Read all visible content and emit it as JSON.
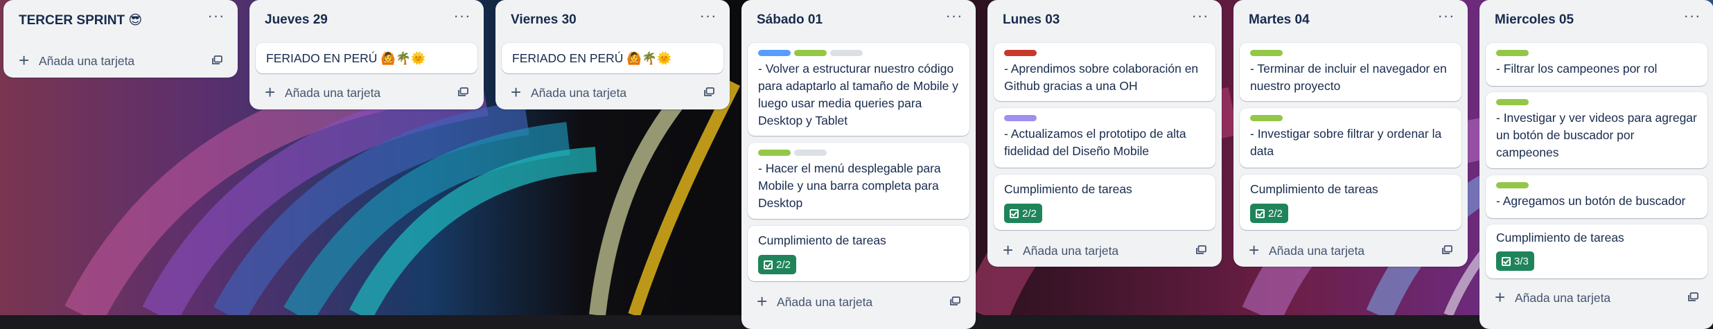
{
  "colors": {
    "list_bg": "#f1f2f4",
    "card_bg": "#ffffff",
    "badge_complete": "#1f845a",
    "label_blue": "#579dff",
    "label_green": "#94c748",
    "label_gray": "#dcdfe4",
    "label_red": "#c9372c",
    "label_purple": "#9f8fef"
  },
  "lists": [
    {
      "title": "TERCER SPRINT 😎",
      "menu": "···",
      "add_label": "Añada una tarjeta",
      "cards": []
    },
    {
      "title": "Jueves 29",
      "menu": "···",
      "add_label": "Añada una tarjeta",
      "cards": [
        {
          "text": "FERIADO EN PERÚ 🙆🌴🌞"
        }
      ]
    },
    {
      "title": "Viernes 30",
      "menu": "···",
      "add_label": "Añada una tarjeta",
      "cards": [
        {
          "text": "FERIADO EN PERÚ 🙆🌴🌞"
        }
      ]
    },
    {
      "title": "Sábado 01",
      "menu": "···",
      "add_label": "Añada una tarjeta",
      "cards": [
        {
          "labels": [
            "blue",
            "green",
            "gray"
          ],
          "text": "- Volver a estructurar nuestro código para adaptarlo al tamaño de Mobile y luego usar media queries para Desktop y Tablet"
        },
        {
          "labels": [
            "green",
            "gray"
          ],
          "text": "- Hacer el menú desplegable para Mobile y una barra completa para Desktop"
        },
        {
          "text": "Cumplimiento de tareas",
          "badge": "2/2"
        }
      ]
    },
    {
      "title": "Lunes 03",
      "menu": "···",
      "add_label": "Añada una tarjeta",
      "cards": [
        {
          "labels": [
            "red"
          ],
          "text": "- Aprendimos sobre colaboración en Github gracias a una OH"
        },
        {
          "labels": [
            "purple"
          ],
          "text": "- Actualizamos el prototipo de alta fidelidad del Diseño Mobile"
        },
        {
          "text": "Cumplimiento de tareas",
          "badge": "2/2"
        }
      ]
    },
    {
      "title": "Martes 04",
      "menu": "···",
      "add_label": "Añada una tarjeta",
      "cards": [
        {
          "labels": [
            "green"
          ],
          "text": "- Terminar de incluir el navegador en nuestro proyecto"
        },
        {
          "labels": [
            "green"
          ],
          "text": "- Investigar sobre filtrar y ordenar la data"
        },
        {
          "text": "Cumplimiento de tareas",
          "badge": "2/2"
        }
      ]
    },
    {
      "title": "Miercoles 05",
      "menu": "···",
      "add_label": "Añada una tarjeta",
      "cards": [
        {
          "labels": [
            "green"
          ],
          "text": "- Filtrar los campeones por rol"
        },
        {
          "labels": [
            "green"
          ],
          "text": "- Investigar y ver videos para agregar un botón de buscador por campeones"
        },
        {
          "labels": [
            "green"
          ],
          "text": "- Agregamos un botón de buscador"
        },
        {
          "text": "Cumplimiento de tareas",
          "badge": "3/3"
        }
      ]
    }
  ]
}
